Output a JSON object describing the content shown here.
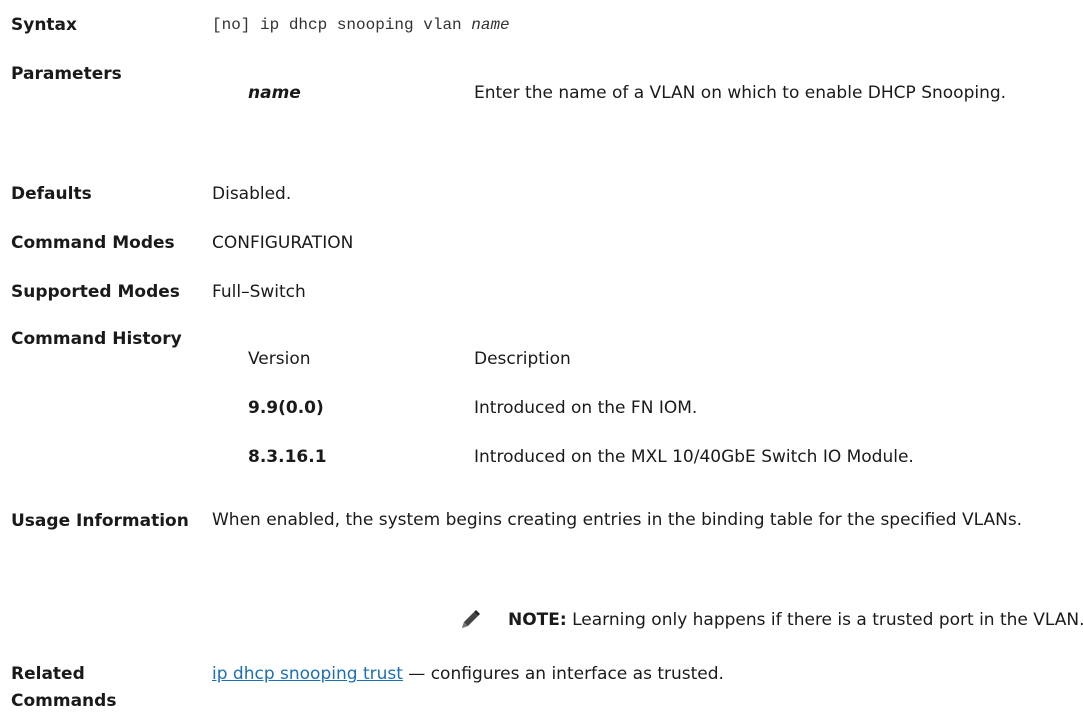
{
  "syntax": {
    "label": "Syntax",
    "prefix": "[no] ip dhcp snooping vlan ",
    "arg": "name"
  },
  "parameters": {
    "label": "Parameters",
    "name": "name",
    "description": "Enter the name of a VLAN on which to enable DHCP Snooping."
  },
  "defaults": {
    "label": "Defaults",
    "value": "Disabled."
  },
  "command_modes": {
    "label": "Command Modes",
    "value": "CONFIGURATION"
  },
  "supported_modes": {
    "label": "Supported Modes",
    "value": "Full–Switch"
  },
  "command_history": {
    "label": "Command History",
    "headers": {
      "version": "Version",
      "description": "Description"
    },
    "rows": [
      {
        "version": "9.9(0.0)",
        "description": "Introduced on the FN IOM."
      },
      {
        "version": "8.3.16.1",
        "description": "Introduced on the MXL 10/40GbE Switch IO Module."
      }
    ]
  },
  "usage": {
    "label": "Usage Information",
    "text": "When enabled, the system begins creating entries in the binding table for the specified VLANs.",
    "note_label": "NOTE:",
    "note_text": " Learning only happens if there is a trusted port in the VLAN.",
    "note_icon": "pencil-note-icon"
  },
  "related": {
    "label_line1": "Related",
    "label_line2": "Commands",
    "link_text": "ip dhcp snooping trust",
    "text": " — configures an interface as trusted."
  }
}
